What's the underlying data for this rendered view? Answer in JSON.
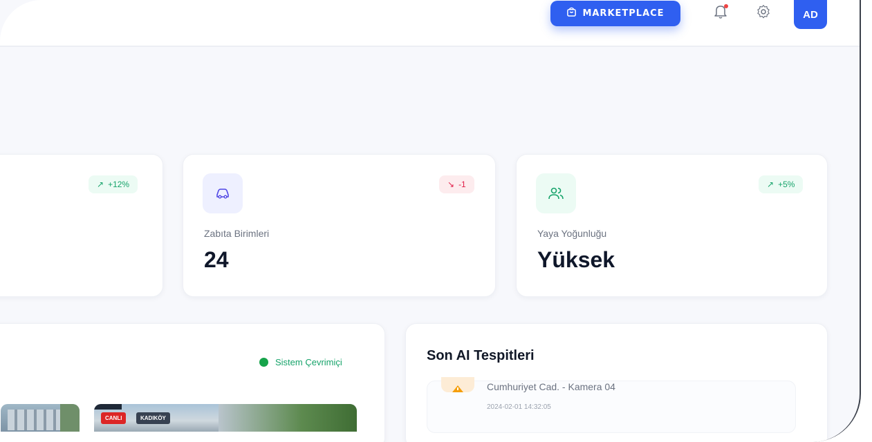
{
  "header": {
    "marketplace_label": "MARKETPLACE",
    "avatar_initials": "AD",
    "notification_unread": true
  },
  "stats": [
    {
      "label": "",
      "value": "",
      "trend": "+12%",
      "trend_dir": "up"
    },
    {
      "label": "Zabıta Birimleri",
      "value": "24",
      "trend": "-1",
      "trend_dir": "down",
      "icon": "car-icon"
    },
    {
      "label": "Yaya Yoğunluğu",
      "value": "Yüksek",
      "trend": "+5%",
      "trend_dir": "up",
      "icon": "users-icon"
    }
  ],
  "cameras_panel": {
    "status": "Sistem Çevrimiçi",
    "feeds": [
      {
        "tags": []
      },
      {
        "tags": [
          "CANLI",
          "KADIKÖY"
        ]
      }
    ]
  },
  "detections_panel": {
    "title": "Son AI Tespitleri",
    "items": [
      {
        "location": "Cumhuriyet Cad. - Kamera 04",
        "time": "2024-02-01 14:32:05",
        "icon": "warning-icon"
      }
    ]
  },
  "colors": {
    "accent": "#2f5ff0",
    "positive": "#16a36a",
    "negative": "#e11d48",
    "page_bg": "#f7f8fc"
  }
}
